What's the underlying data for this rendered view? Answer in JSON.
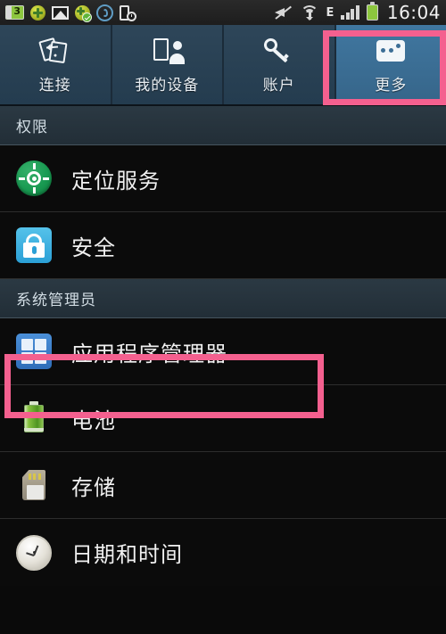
{
  "statusbar": {
    "left_icons": [
      {
        "name": "battery-saver-notification-icon"
      },
      {
        "name": "green-plus-notification-icon"
      },
      {
        "name": "picture-notification-icon"
      },
      {
        "name": "green-plus-check-notification-icon"
      },
      {
        "name": "swirl-app-notification-icon"
      },
      {
        "name": "device-clock-notification-icon"
      }
    ],
    "right_icons": [
      {
        "name": "mute-icon"
      },
      {
        "name": "wifi-icon"
      }
    ],
    "network_type": "E",
    "signal_name": "signal-bars-icon",
    "battery_name": "battery-icon",
    "clock": "16:04"
  },
  "tabs": [
    {
      "label": "连接",
      "icon": "connections-icon",
      "active": false
    },
    {
      "label": "我的设备",
      "icon": "my-device-icon",
      "active": false
    },
    {
      "label": "账户",
      "icon": "key-icon",
      "active": false
    },
    {
      "label": "更多",
      "icon": "more-dots-icon",
      "active": true
    }
  ],
  "sections": [
    {
      "header": "权限",
      "items": [
        {
          "label": "定位服务",
          "icon": "location-services-icon"
        },
        {
          "label": "安全",
          "icon": "security-lock-icon"
        }
      ]
    },
    {
      "header": "系统管理员",
      "items": [
        {
          "label": "应用程序管理器",
          "icon": "application-manager-icon",
          "highlighted": true
        },
        {
          "label": "电池",
          "icon": "battery-icon"
        },
        {
          "label": "存储",
          "icon": "storage-sdcard-icon"
        },
        {
          "label": "日期和时间",
          "icon": "date-time-clock-icon"
        }
      ]
    }
  ],
  "highlights": {
    "accent_color": "#f4608f",
    "more_tab_label": "更多",
    "app_manager_label": "应用程序管理器"
  },
  "colors": {
    "tab_active_bg": "#3c6e96",
    "tab_inactive_bg": "#2a4256",
    "section_header_bg": "#26323c",
    "list_bg": "#0b0b0b",
    "text_primary": "#f0f0f0"
  }
}
